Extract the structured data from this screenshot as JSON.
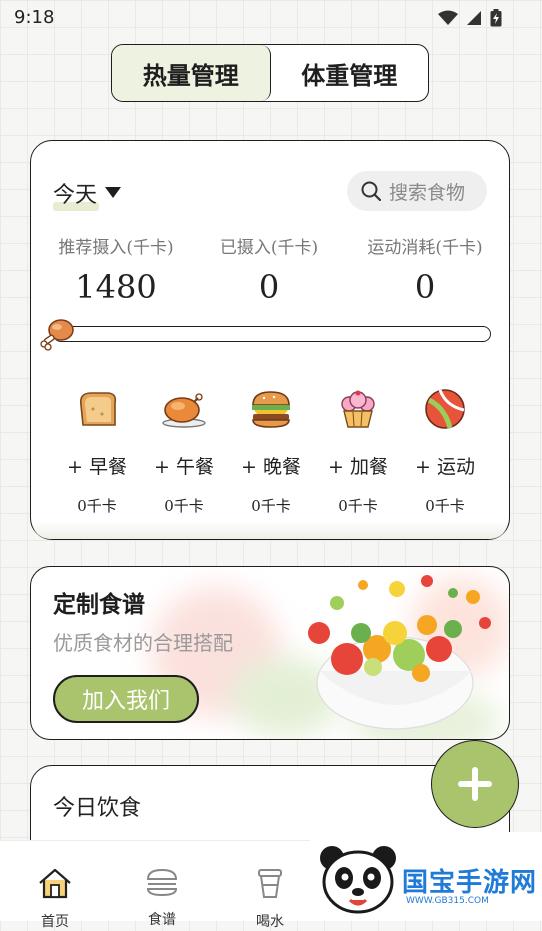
{
  "status": {
    "time": "9:18"
  },
  "tabs": [
    {
      "label": "热量管理",
      "active": true
    },
    {
      "label": "体重管理",
      "active": false
    }
  ],
  "summary": {
    "day_label": "今天",
    "search_placeholder": "搜索食物",
    "stats": [
      {
        "label": "推荐摄入(千卡)",
        "value": "1480"
      },
      {
        "label": "已摄入(千卡)",
        "value": "0"
      },
      {
        "label": "运动消耗(千卡)",
        "value": "0"
      }
    ],
    "progress_fraction": 0,
    "meals": [
      {
        "label": "+ 早餐",
        "kcal": "0千卡",
        "icon": "bread-icon"
      },
      {
        "label": "+ 午餐",
        "kcal": "0千卡",
        "icon": "roast-chicken-icon"
      },
      {
        "label": "+ 晚餐",
        "kcal": "0千卡",
        "icon": "burger-icon"
      },
      {
        "label": "+ 加餐",
        "kcal": "0千卡",
        "icon": "cupcake-icon"
      },
      {
        "label": "+ 运动",
        "kcal": "0千卡",
        "icon": "ball-icon"
      }
    ]
  },
  "banner": {
    "title": "定制食谱",
    "subtitle": "优质食材的合理搭配",
    "button": "加入我们"
  },
  "today": {
    "title": "今日饮食"
  },
  "nav": [
    {
      "label": "首页",
      "icon": "home-icon"
    },
    {
      "label": "食谱",
      "icon": "burger-outline-icon"
    },
    {
      "label": "喝水",
      "icon": "cup-icon"
    }
  ],
  "watermark": {
    "title": "国宝手游网",
    "url": "WWW.GB315.COM"
  },
  "colors": {
    "accent": "#a9c46c",
    "accent_light": "#eef2e1",
    "outline": "#1e1e1e"
  }
}
